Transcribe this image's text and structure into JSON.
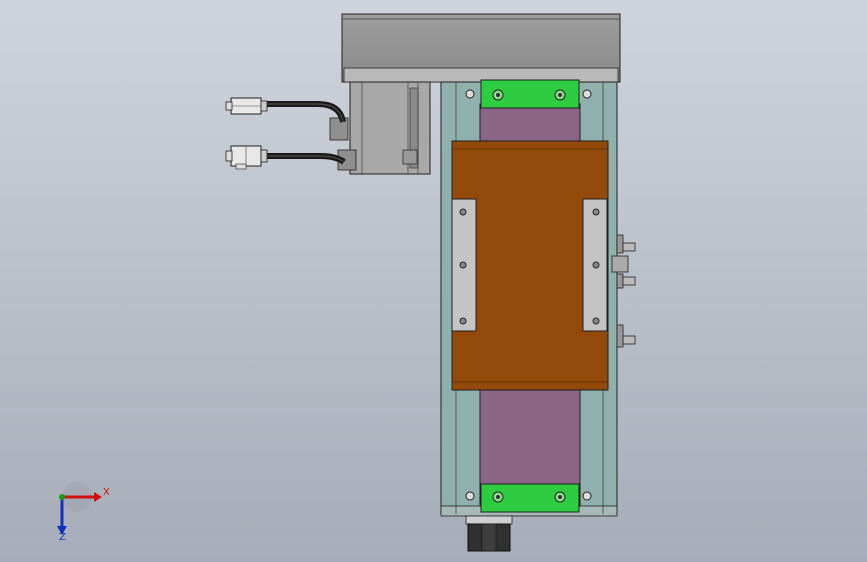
{
  "viewport": {
    "background_top": "#cfd4dc",
    "background_bottom": "#a6adb8"
  },
  "model": {
    "colors": {
      "base_plate": "#8fb0ac",
      "belt": "#8a6585",
      "carriage": "#934a0a",
      "bracket": "#c4c4c4",
      "end_block": "#2ecc40",
      "motor_housing": "#a8a8a8",
      "motor_flange": "#9a9a9a",
      "edge": "#202020"
    },
    "icons": {
      "motor": "motor-icon",
      "connector": "connector-icon",
      "sensor": "sensor-icon"
    }
  },
  "triad": {
    "x_label": "X",
    "z_label": "Z",
    "x_color": "#d01010",
    "y_color": "#10a010",
    "z_color": "#1030c0"
  }
}
